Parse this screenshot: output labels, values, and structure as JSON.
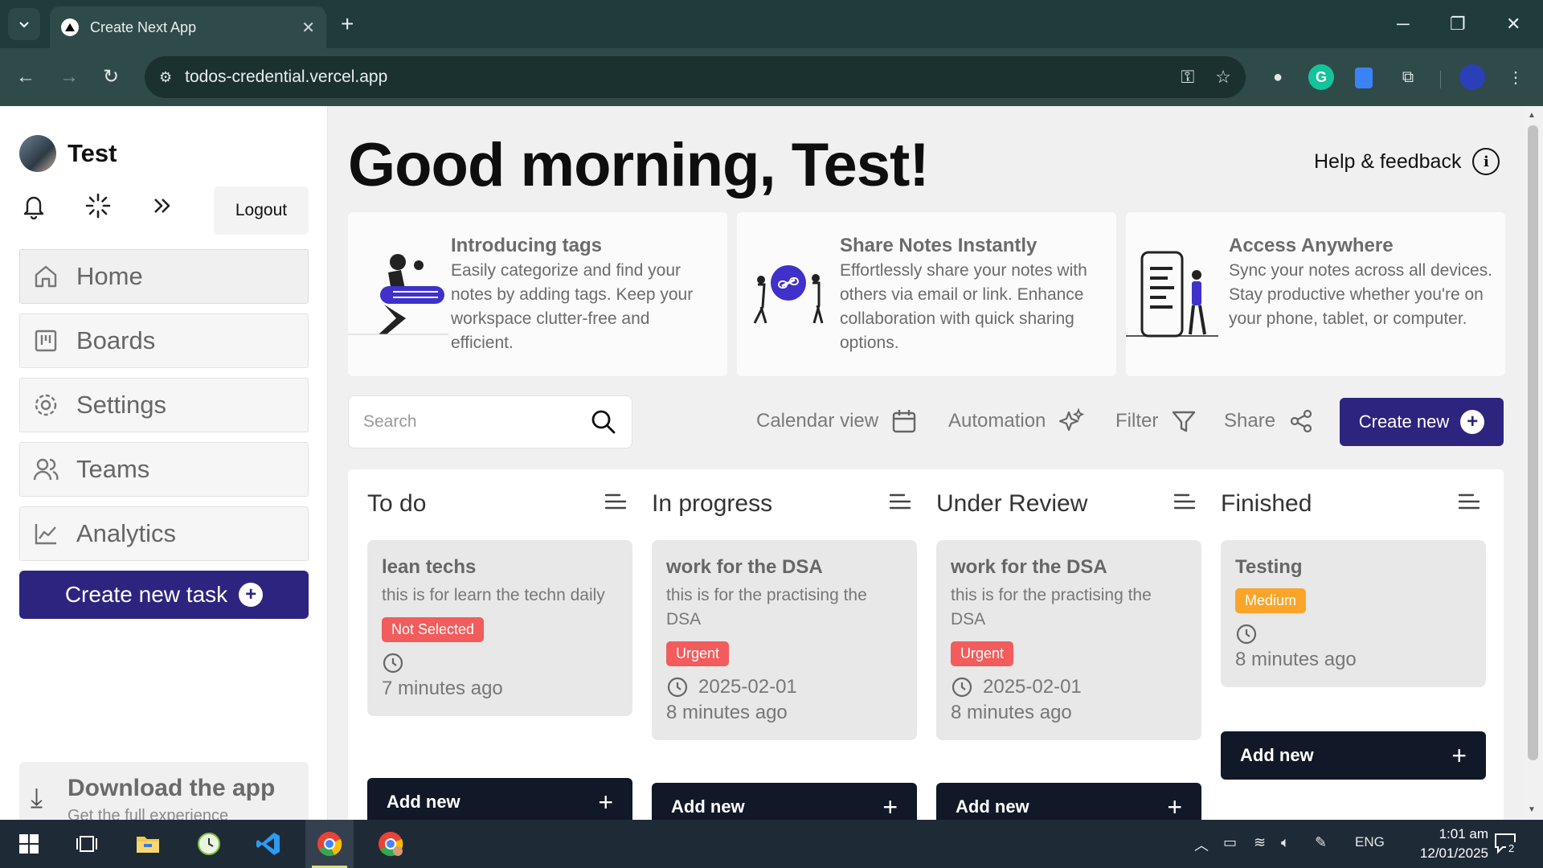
{
  "browser": {
    "tab_title": "Create Next App",
    "url": "todos-credential.vercel.app"
  },
  "sidebar": {
    "user_name": "Test",
    "logout_label": "Logout",
    "nav": [
      {
        "label": "Home",
        "icon": "home-icon"
      },
      {
        "label": "Boards",
        "icon": "boards-icon"
      },
      {
        "label": "Settings",
        "icon": "gear-icon"
      },
      {
        "label": "Teams",
        "icon": "users-icon"
      },
      {
        "label": "Analytics",
        "icon": "chart-line-icon"
      }
    ],
    "create_task_label": "Create new task",
    "download": {
      "title": "Download the app",
      "subtitle": "Get the full experience"
    }
  },
  "main": {
    "greeting": "Good morning, Test!",
    "help_label": "Help & feedback",
    "features": [
      {
        "title": "Introducing tags",
        "desc": "Easily categorize and find your notes by adding tags. Keep your workspace clutter-free and efficient."
      },
      {
        "title": "Share Notes Instantly",
        "desc": "Effortlessly share your notes with others via email or link. Enhance collaboration with quick sharing options."
      },
      {
        "title": "Access Anywhere",
        "desc": "Sync your notes across all devices. Stay productive whether you're on your phone, tablet, or computer."
      }
    ],
    "search_placeholder": "Search",
    "toolbar": {
      "calendar_view": "Calendar view",
      "automation": "Automation",
      "filter": "Filter",
      "share": "Share",
      "create_new": "Create new"
    },
    "columns": [
      {
        "title": "To do",
        "cards": [
          {
            "title": "lean techs",
            "desc": "this is for learn the techn daily",
            "priority": "Not Selected",
            "priority_color": "#f25c5c",
            "due": "",
            "ago": "7 minutes ago"
          }
        ],
        "add_label": "Add new"
      },
      {
        "title": "In progress",
        "cards": [
          {
            "title": "work for the DSA",
            "desc": "this is for the practising the DSA",
            "priority": "Urgent",
            "priority_color": "#f25c5c",
            "due": "2025-02-01",
            "ago": "8 minutes ago"
          }
        ],
        "add_label": "Add new"
      },
      {
        "title": "Under Review",
        "cards": [
          {
            "title": "work for the DSA",
            "desc": "this is for the practising the DSA",
            "priority": "Urgent",
            "priority_color": "#f25c5c",
            "due": "2025-02-01",
            "ago": "8 minutes ago"
          }
        ],
        "add_label": "Add new"
      },
      {
        "title": "Finished",
        "cards": [
          {
            "title": "Testing",
            "desc": "",
            "priority": "Medium",
            "priority_color": "#fba42a",
            "due": "",
            "ago": "8 minutes ago"
          }
        ],
        "add_label": "Add new"
      }
    ]
  },
  "taskbar": {
    "language": "ENG",
    "time": "1:01 am",
    "date": "12/01/2025",
    "notification_count": "2"
  },
  "colors": {
    "accent": "#2d2480",
    "dark_button": "#111827",
    "urgent": "#f25c5c",
    "medium": "#fba42a"
  }
}
